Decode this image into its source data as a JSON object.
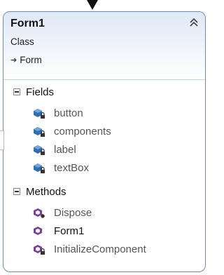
{
  "class": {
    "name": "Form1",
    "stereotype": "Class",
    "base_class": "Form",
    "collapse_icon": "double-chevron-up-icon"
  },
  "fields": {
    "label": "Fields",
    "items": [
      {
        "name": "button",
        "icon": "private-field-icon"
      },
      {
        "name": "components",
        "icon": "private-field-icon"
      },
      {
        "name": "label",
        "icon": "private-field-icon"
      },
      {
        "name": "textBox",
        "icon": "private-field-icon"
      }
    ]
  },
  "methods": {
    "label": "Methods",
    "items": [
      {
        "name": "Dispose",
        "icon": "protected-method-icon"
      },
      {
        "name": "Form1",
        "icon": "public-method-icon"
      },
      {
        "name": "InitializeComponent",
        "icon": "private-method-icon"
      }
    ]
  },
  "colors": {
    "border": "#6b8bb8",
    "header_gradient_top": "#dfe8f5",
    "field_icon": "#2f6fb0",
    "method_icon": "#7b3fa0"
  }
}
